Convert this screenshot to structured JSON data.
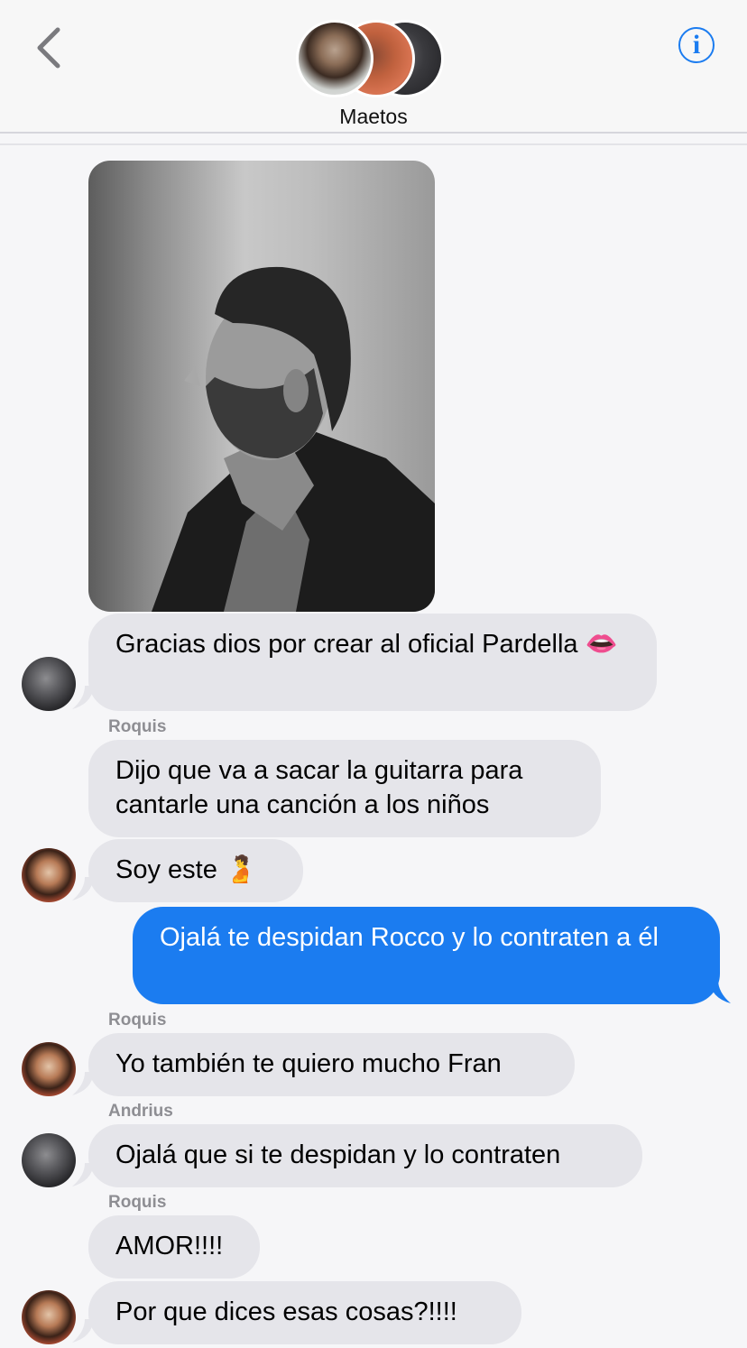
{
  "header": {
    "group_name": "Maetos",
    "back_icon": "chevron-left-icon",
    "info_icon": "info-icon",
    "info_glyph": "i",
    "accent_color": "#1b7cf0"
  },
  "messages": [
    {
      "type": "photo",
      "description_icon": "image"
    },
    {
      "text": "Gracias dios por crear al oficial Pardella 👄"
    },
    {
      "sender": "Roquis",
      "text": "Dijo que va a sacar la guitarra para cantarle una canción a los niños"
    },
    {
      "text": "Soy este 🫄"
    },
    {
      "text": "Ojalá te despidan Rocco y lo contraten a él",
      "outgoing": true
    },
    {
      "sender": "Roquis",
      "text": "Yo también te quiero mucho Fran"
    },
    {
      "sender": "Andrius",
      "text": "Ojalá que si te despidan y lo contraten"
    },
    {
      "sender": "Roquis",
      "text": "AMOR!!!!"
    },
    {
      "text": "Por que dices esas cosas?!!!!"
    }
  ],
  "colors": {
    "incoming_bubble": "#e5e5ea",
    "outgoing_bubble": "#1b7cf0",
    "sender_label": "#8e8e93"
  }
}
